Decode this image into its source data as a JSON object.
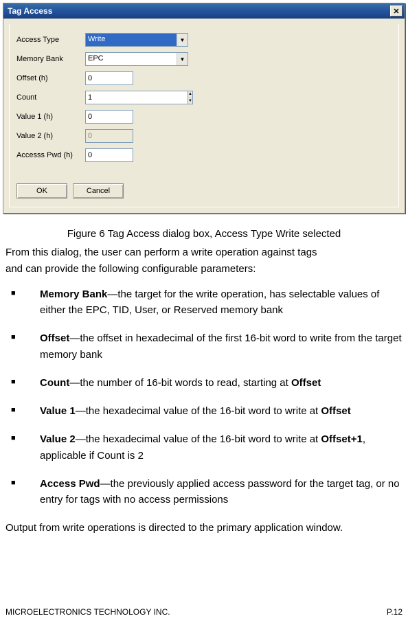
{
  "dialog": {
    "title": "Tag Access",
    "fields": {
      "access_type": {
        "label": "Access Type",
        "value": "Write"
      },
      "memory_bank": {
        "label": "Memory Bank",
        "value": "EPC"
      },
      "offset": {
        "label": "Offset (h)",
        "value": "0"
      },
      "count": {
        "label": "Count",
        "value": "1"
      },
      "value1": {
        "label": "Value 1 (h)",
        "value": "0"
      },
      "value2": {
        "label": "Value 2 (h)",
        "value": "0"
      },
      "access_pwd": {
        "label": "Accesss Pwd (h)",
        "value": "0"
      }
    },
    "buttons": {
      "ok": "OK",
      "cancel": "Cancel"
    }
  },
  "doc": {
    "caption": "Figure 6 Tag Access dialog box, Access Type Write selected",
    "intro1": "From this dialog, the user can perform a write operation against tags",
    "intro2": "and can provide the following configurable parameters:",
    "items": [
      {
        "term": "Memory Bank",
        "desc": "—the target for the write operation, has selectable values of either the EPC, TID, User, or Reserved memory bank"
      },
      {
        "term": "Offset",
        "desc": "—the offset in hexadecimal of the first 16-bit word to write from the target memory bank"
      },
      {
        "term": "Count",
        "desc_pre": "—the number of 16-bit words to read, starting at ",
        "bold_tail": "Offset"
      },
      {
        "term": "Value 1",
        "desc_pre": "—the hexadecimal value of the 16-bit word to write at ",
        "bold_tail": "Offset"
      },
      {
        "term": "Value 2",
        "desc_pre": "—the hexadecimal value of the 16-bit word to write at ",
        "bold_tail": "Offset+1",
        "desc_post": ", applicable if Count is 2"
      },
      {
        "term": "Access Pwd",
        "desc": "—the previously applied access password for the target tag, or no entry for tags with no access permissions"
      }
    ],
    "outro": "Output from write operations is directed to the primary application window."
  },
  "footer": {
    "company": "MICROELECTRONICS TECHNOLOGY INC.",
    "page": "P.12"
  }
}
